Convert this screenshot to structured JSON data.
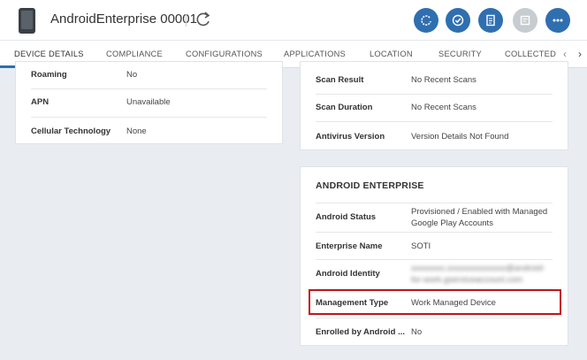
{
  "header": {
    "title": "AndroidEnterprise 00001",
    "device_icon": "android-phone-icon",
    "refresh_icon": "refresh-icon",
    "actions": [
      {
        "name": "sync-icon",
        "enabled": true
      },
      {
        "name": "check-icon",
        "enabled": true
      },
      {
        "name": "document-icon",
        "enabled": true
      },
      {
        "name": "message-icon",
        "enabled": false
      },
      {
        "name": "more-icon",
        "enabled": true
      }
    ],
    "accent_color": "#2f6fb0"
  },
  "tabs": [
    {
      "label": "DEVICE DETAILS",
      "active": true
    },
    {
      "label": "COMPLIANCE"
    },
    {
      "label": "CONFIGURATIONS"
    },
    {
      "label": "APPLICATIONS"
    },
    {
      "label": "LOCATION"
    },
    {
      "label": "SECURITY"
    },
    {
      "label": "COLLECTED DATA"
    }
  ],
  "network_card": {
    "rows": [
      {
        "label": "Roaming",
        "value": "No"
      },
      {
        "label": "APN",
        "value": "Unavailable"
      },
      {
        "label": "Cellular Technology",
        "value": "None"
      }
    ]
  },
  "security_card": {
    "rows": [
      {
        "label": "Scan Result",
        "value": "No Recent Scans"
      },
      {
        "label": "Scan Duration",
        "value": "No Recent Scans"
      },
      {
        "label": "Antivirus Version",
        "value": "Version Details Not Found"
      }
    ]
  },
  "android_enterprise": {
    "title": "ANDROID ENTERPRISE",
    "rows": [
      {
        "label": "Android Status",
        "value": "Provisioned / Enabled with Managed Google Play Accounts"
      },
      {
        "label": "Enterprise Name",
        "value": "SOTI"
      },
      {
        "label": "Android Identity",
        "value": "xxxxxxxx.xxxxxxxxxxxxxx@android-for-work.gserviceaccount.com"
      },
      {
        "label": "Management Type",
        "value": "Work Managed Device"
      },
      {
        "label": "Enrolled by Android ...",
        "value": "No"
      }
    ],
    "highlight_color": "#c0161c"
  }
}
